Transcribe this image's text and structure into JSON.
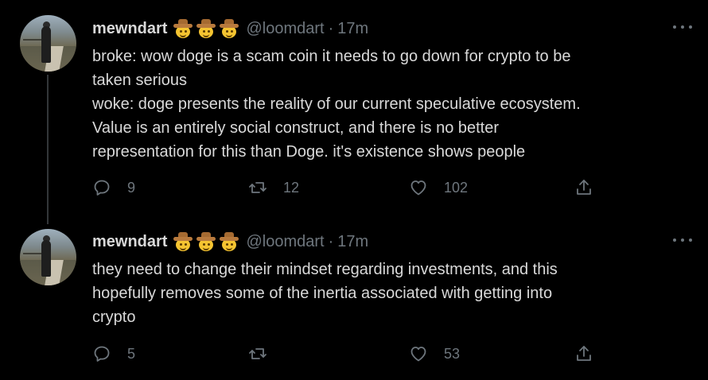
{
  "tweets": [
    {
      "author": {
        "name": "mewndart",
        "emojis": [
          "cowboy-hat-face",
          "cowboy-hat-face",
          "cowboy-hat-face"
        ],
        "handle": "@loomdart"
      },
      "separator": "·",
      "time": "17m",
      "lines": [
        "broke: wow doge is a scam coin it needs to go down for crypto to be",
        "taken serious",
        "woke: doge presents the reality of our current speculative ecosystem.",
        "Value is an entirely social construct, and there is no better",
        "representation for this than Doge. it's existence shows people"
      ],
      "actions": {
        "replies": "9",
        "retweets": "12",
        "likes": "102"
      }
    },
    {
      "author": {
        "name": "mewndart",
        "emojis": [
          "cowboy-hat-face",
          "cowboy-hat-face",
          "cowboy-hat-face"
        ],
        "handle": "@loomdart"
      },
      "separator": "·",
      "time": "17m",
      "lines": [
        "they need to change their mindset regarding investments, and this",
        "hopefully removes some of the inertia associated with getting into",
        "crypto"
      ],
      "actions": {
        "replies": "5",
        "retweets": "",
        "likes": "53"
      }
    }
  ],
  "colors": {
    "background": "#000000",
    "text": "#d9d9d9",
    "muted": "#6e767d",
    "thread_line": "#333639"
  }
}
